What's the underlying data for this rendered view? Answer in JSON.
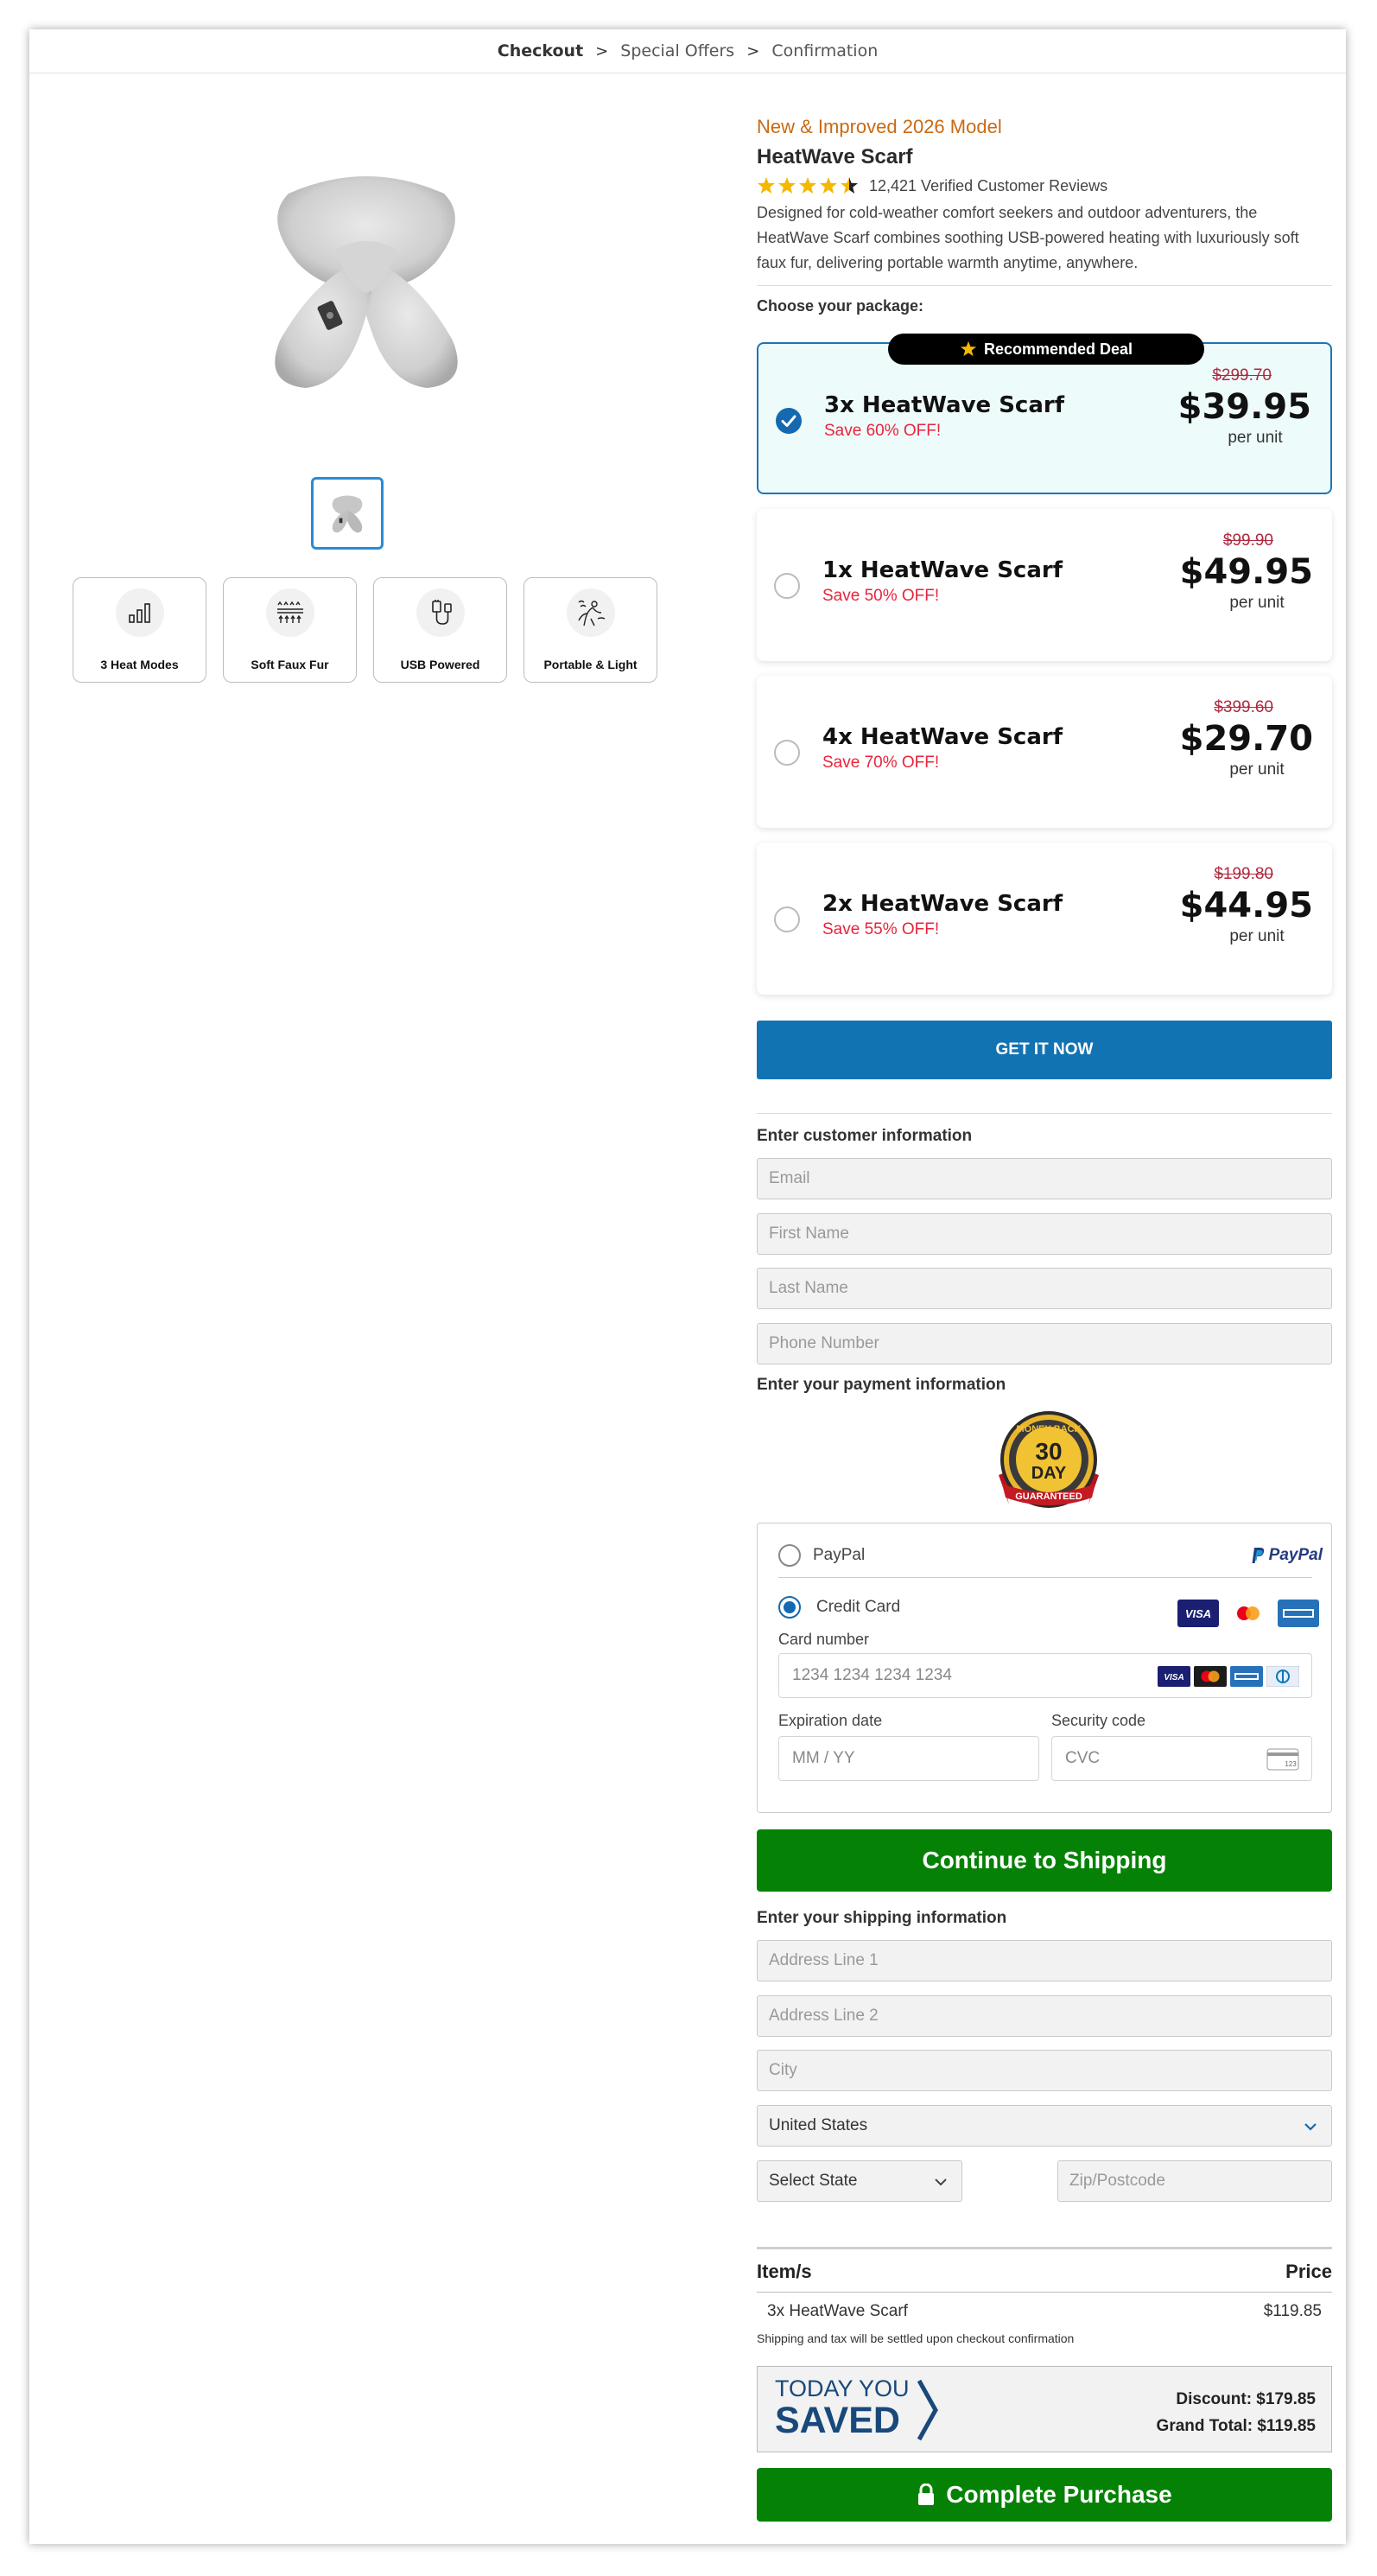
{
  "breadcrumb": {
    "step1": "Checkout",
    "step2": "Special Offers",
    "step3": "Confirmation",
    "sep": ">"
  },
  "product": {
    "tagline": "New & Improved 2026 Model",
    "title": "HeatWave Scarf",
    "reviews": "12,421 Verified Customer Reviews",
    "rating": 4.5,
    "description": "Designed for cold-weather comfort seekers and outdoor adventurers, the HeatWave Scarf combines soothing USB-powered heating with luxuriously soft faux fur, delivering portable warmth anytime, anywhere."
  },
  "features": [
    {
      "label": "3 Heat Modes",
      "icon": "signal-bars-icon"
    },
    {
      "label": "Soft Faux Fur",
      "icon": "faux-fur-icon"
    },
    {
      "label": "USB Powered",
      "icon": "usb-plug-icon"
    },
    {
      "label": "Portable & Light",
      "icon": "portable-icon"
    }
  ],
  "packages": {
    "choose_label": "Choose your package:",
    "badge": "Recommended Deal",
    "items": [
      {
        "name": "3x HeatWave Scarf",
        "save": "Save 60% OFF!",
        "old": "$299.70",
        "price": "$39.95",
        "unit": "per unit",
        "selected": true
      },
      {
        "name": "1x HeatWave Scarf",
        "save": "Save 50% OFF!",
        "old": "$99.90",
        "price": "$49.95",
        "unit": "per unit",
        "selected": false
      },
      {
        "name": "4x HeatWave Scarf",
        "save": "Save 70% OFF!",
        "old": "$399.60",
        "price": "$29.70",
        "unit": "per unit",
        "selected": false
      },
      {
        "name": "2x HeatWave Scarf",
        "save": "Save 55% OFF!",
        "old": "$199.80",
        "price": "$44.95",
        "unit": "per unit",
        "selected": false
      }
    ]
  },
  "cta": {
    "get_it": "GET IT NOW",
    "continue": "Continue to Shipping",
    "complete": "Complete Purchase"
  },
  "customer": {
    "label": "Enter customer information",
    "email": "Email",
    "first": "First Name",
    "last": "Last Name",
    "phone": "Phone Number"
  },
  "payment": {
    "label": "Enter your payment information",
    "guarantee_text": [
      "MONEY BACK",
      "30",
      "DAY",
      "GUARANTEED"
    ],
    "paypal": "PayPal",
    "paypal_logo": "PayPal",
    "credit": "Credit Card",
    "card_number_label": "Card number",
    "card_number_placeholder": "1234 1234 1234 1234",
    "exp_label": "Expiration date",
    "exp_placeholder": "MM / YY",
    "cvc_label": "Security code",
    "cvc_placeholder": "CVC",
    "visa": "VISA",
    "cvc_icon_text": "123",
    "selected": "Credit Card"
  },
  "shipping": {
    "label": "Enter your shipping information",
    "address1": "Address Line 1",
    "address2": "Address Line 2",
    "city": "City",
    "country": "United States",
    "state": "Select State",
    "zip": "Zip/Postcode"
  },
  "summary": {
    "col_item": "Item/s",
    "col_price": "Price",
    "item": "3x HeatWave Scarf",
    "item_price": "$119.85",
    "note": "Shipping and tax will be settled upon checkout confirmation",
    "saved_line1": "TODAY YOU",
    "saved_line2": "SAVED",
    "discount": "Discount: $179.85",
    "grand_total": "Grand Total: $119.85"
  },
  "colors": {
    "accent_blue": "#1273b3",
    "cta_green": "#058205",
    "sale_red": "#e8243c",
    "tagline_orange": "#c96a12"
  }
}
